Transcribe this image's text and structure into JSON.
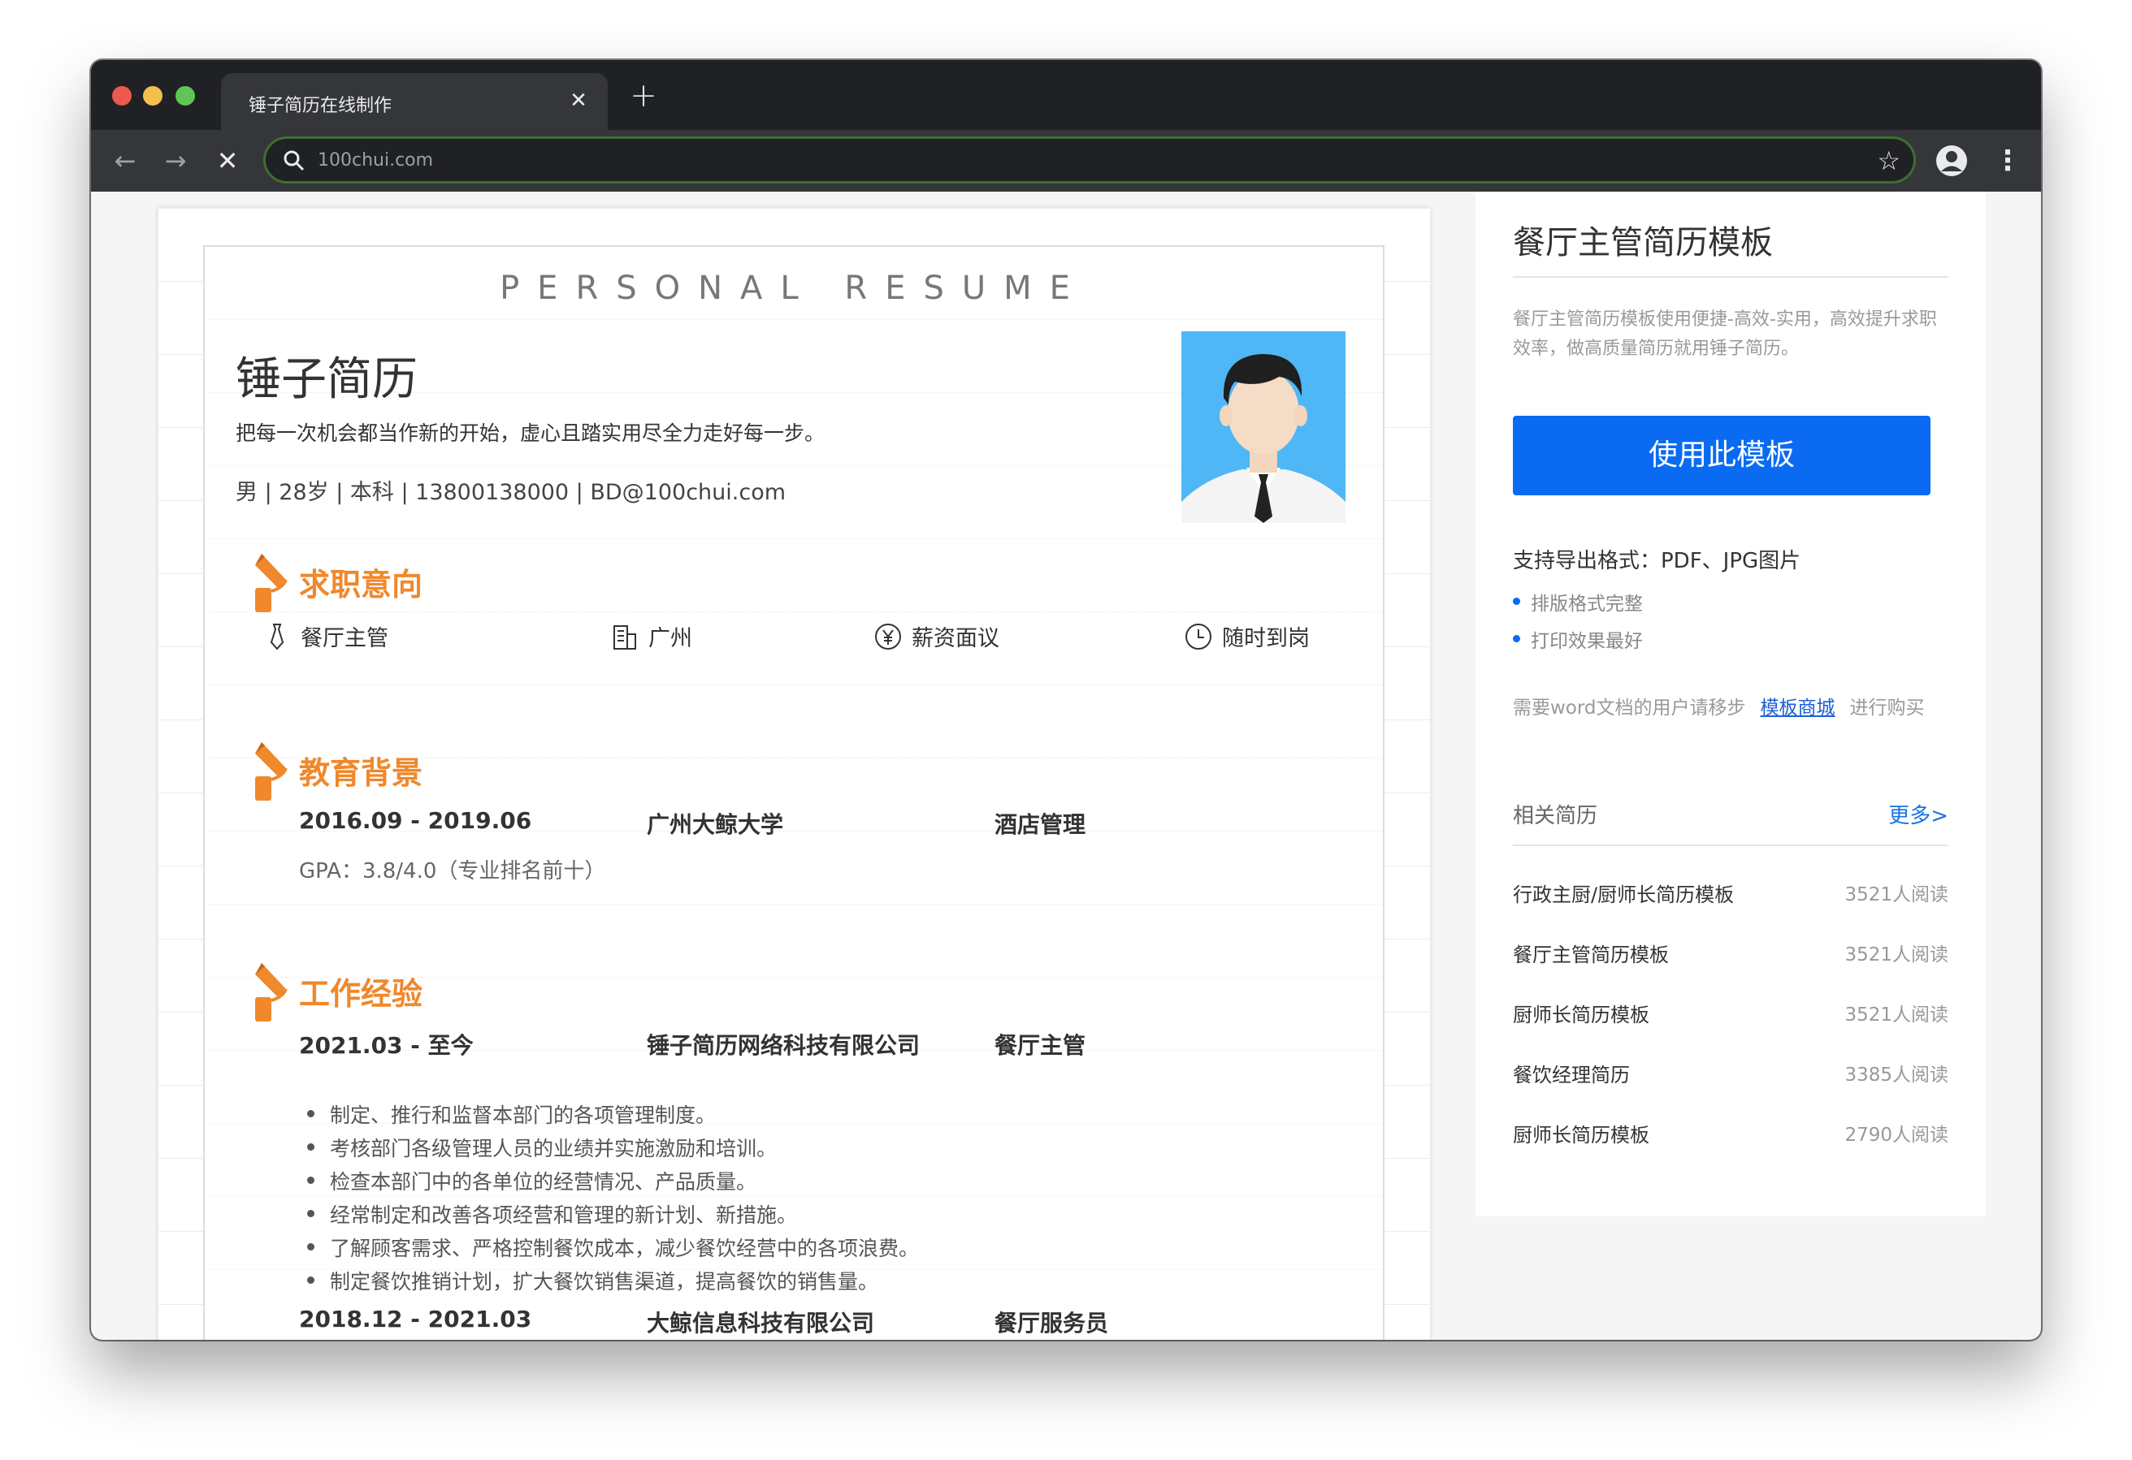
{
  "browser": {
    "tab_title": "锤子简历在线制作",
    "tab_close": "✕",
    "new_tab": "+",
    "url": "100chui.com",
    "back": "←",
    "forward": "→",
    "stop": "✕",
    "star": "☆",
    "kebab": "⋮"
  },
  "resume": {
    "header": "PERSONAL RESUME",
    "name": "锤子简历",
    "motto": "把每一次机会都当作新的开始，虚心且踏实用尽全力走好每一步。",
    "contact": "男 | 28岁 | 本科 | 13800138000 | BD@100chui.com",
    "sections": {
      "intent": "求职意向",
      "education": "教育背景",
      "work": "工作经验"
    },
    "intent": [
      {
        "icon": "tie-icon",
        "label": "餐厅主管"
      },
      {
        "icon": "building-icon",
        "label": "广州"
      },
      {
        "icon": "yen-icon",
        "label": "薪资面议"
      },
      {
        "icon": "clock-icon",
        "label": "随时到岗"
      }
    ],
    "education": {
      "period": "2016.09 - 2019.06",
      "school": "广州大鲸大学",
      "major": "酒店管理",
      "gpa": "GPA：3.8/4.0（专业排名前十）"
    },
    "work": [
      {
        "period": "2021.03 - 至今",
        "company": "锤子简历网络科技有限公司",
        "role": "餐厅主管",
        "duties": [
          "制定、推行和监督本部门的各项管理制度。",
          "考核部门各级管理人员的业绩并实施激励和培训。",
          "检查本部门中的各单位的经营情况、产品质量。",
          "经常制定和改善各项经营和管理的新计划、新措施。",
          "了解顾客需求、严格控制餐饮成本，减少餐饮经营中的各项浪费。",
          "制定餐饮推销计划，扩大餐饮销售渠道，提高餐饮的销售量。"
        ]
      },
      {
        "period": "2018.12 - 2021.03",
        "company": "大鲸信息科技有限公司",
        "role": "餐厅服务员"
      }
    ]
  },
  "sidebar": {
    "title": "餐厅主管简历模板",
    "description": "餐厅主管简历模板使用便捷-高效-实用，高效提升求职效率，做高质量简历就用锤子简历。",
    "use_button": "使用此模板",
    "formats": "支持导出格式：PDF、JPG图片",
    "bullets": [
      "排版格式完整",
      "打印效果最好"
    ],
    "word_note_prefix": "需要word文档的用户请移步",
    "word_link": "模板商城",
    "word_note_suffix": "进行购买",
    "related_title": "相关简历",
    "more": "更多>",
    "related": [
      {
        "name": "行政主厨/厨师长简历模板",
        "reads": "3521人阅读"
      },
      {
        "name": "餐厅主管简历模板",
        "reads": "3521人阅读"
      },
      {
        "name": "厨师长简历模板",
        "reads": "3521人阅读"
      },
      {
        "name": "餐饮经理简历",
        "reads": "3385人阅读"
      },
      {
        "name": "厨师长简历模板",
        "reads": "2790人阅读"
      }
    ]
  },
  "colors": {
    "accent_orange": "#f0882c",
    "primary_blue": "#0a6bf2",
    "photo_bg": "#4fb7f5"
  }
}
